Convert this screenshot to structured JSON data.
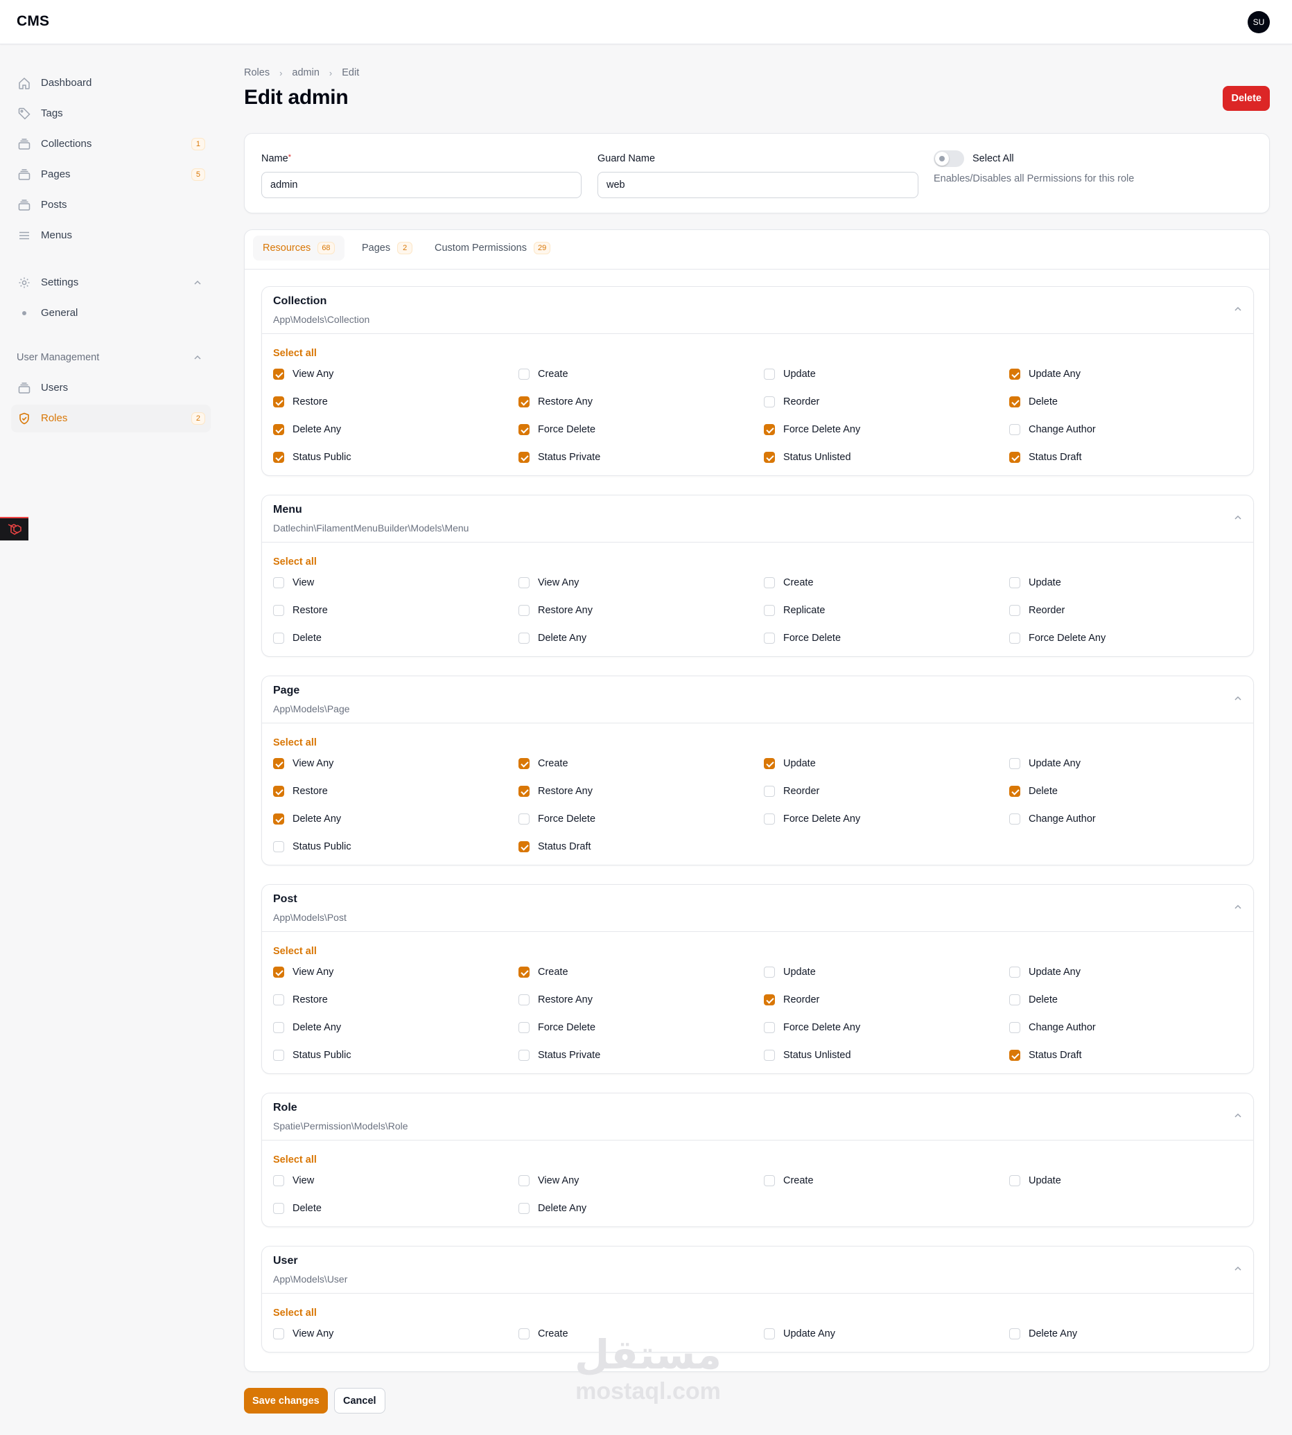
{
  "app": {
    "title": "CMS",
    "user_initials": "SU"
  },
  "sidebar": {
    "items": [
      {
        "label": "Dashboard",
        "icon": "home-icon"
      },
      {
        "label": "Tags",
        "icon": "tag-icon"
      },
      {
        "label": "Collections",
        "icon": "collection-icon",
        "badge": "1"
      },
      {
        "label": "Pages",
        "icon": "pages-icon",
        "badge": "5"
      },
      {
        "label": "Posts",
        "icon": "posts-icon"
      },
      {
        "label": "Menus",
        "icon": "menu-icon"
      }
    ],
    "settings": {
      "label": "Settings",
      "icon": "gear-icon",
      "children": [
        {
          "label": "General"
        }
      ]
    },
    "user_management": {
      "label": "User Management",
      "items": [
        {
          "label": "Users",
          "icon": "users-icon"
        },
        {
          "label": "Roles",
          "icon": "shield-icon",
          "badge": "2",
          "active": true
        }
      ]
    }
  },
  "breadcrumb": [
    "Roles",
    "admin",
    "Edit"
  ],
  "page": {
    "title": "Edit admin",
    "delete_label": "Delete"
  },
  "form": {
    "name": {
      "label": "Name",
      "required_mark": "*",
      "value": "admin"
    },
    "guard": {
      "label": "Guard Name",
      "value": "web"
    },
    "select_all": {
      "label": "Select All",
      "help": "Enables/Disables all Permissions for this role",
      "on": false
    }
  },
  "tabs": [
    {
      "label": "Resources",
      "count": "68",
      "active": true
    },
    {
      "label": "Pages",
      "count": "2"
    },
    {
      "label": "Custom Permissions",
      "count": "29"
    }
  ],
  "select_all_link": "Select all",
  "sections": [
    {
      "title": "Collection",
      "subtitle": "App\\Models\\Collection",
      "permissions": [
        {
          "label": "View Any",
          "checked": true
        },
        {
          "label": "Create",
          "checked": false
        },
        {
          "label": "Update",
          "checked": false
        },
        {
          "label": "Update Any",
          "checked": true
        },
        {
          "label": "Restore",
          "checked": true
        },
        {
          "label": "Restore Any",
          "checked": true
        },
        {
          "label": "Reorder",
          "checked": false
        },
        {
          "label": "Delete",
          "checked": true
        },
        {
          "label": "Delete Any",
          "checked": true
        },
        {
          "label": "Force Delete",
          "checked": true
        },
        {
          "label": "Force Delete Any",
          "checked": true
        },
        {
          "label": "Change Author",
          "checked": false
        },
        {
          "label": "Status Public",
          "checked": true
        },
        {
          "label": "Status Private",
          "checked": true
        },
        {
          "label": "Status Unlisted",
          "checked": true
        },
        {
          "label": "Status Draft",
          "checked": true
        }
      ]
    },
    {
      "title": "Menu",
      "subtitle": "Datlechin\\FilamentMenuBuilder\\Models\\Menu",
      "permissions": [
        {
          "label": "View",
          "checked": false
        },
        {
          "label": "View Any",
          "checked": false
        },
        {
          "label": "Create",
          "checked": false
        },
        {
          "label": "Update",
          "checked": false
        },
        {
          "label": "Restore",
          "checked": false
        },
        {
          "label": "Restore Any",
          "checked": false
        },
        {
          "label": "Replicate",
          "checked": false
        },
        {
          "label": "Reorder",
          "checked": false
        },
        {
          "label": "Delete",
          "checked": false
        },
        {
          "label": "Delete Any",
          "checked": false
        },
        {
          "label": "Force Delete",
          "checked": false
        },
        {
          "label": "Force Delete Any",
          "checked": false
        }
      ]
    },
    {
      "title": "Page",
      "subtitle": "App\\Models\\Page",
      "permissions": [
        {
          "label": "View Any",
          "checked": true
        },
        {
          "label": "Create",
          "checked": true
        },
        {
          "label": "Update",
          "checked": true
        },
        {
          "label": "Update Any",
          "checked": false
        },
        {
          "label": "Restore",
          "checked": true
        },
        {
          "label": "Restore Any",
          "checked": true
        },
        {
          "label": "Reorder",
          "checked": false
        },
        {
          "label": "Delete",
          "checked": true
        },
        {
          "label": "Delete Any",
          "checked": true
        },
        {
          "label": "Force Delete",
          "checked": false
        },
        {
          "label": "Force Delete Any",
          "checked": false
        },
        {
          "label": "Change Author",
          "checked": false
        },
        {
          "label": "Status Public",
          "checked": false
        },
        {
          "label": "Status Draft",
          "checked": true
        }
      ]
    },
    {
      "title": "Post",
      "subtitle": "App\\Models\\Post",
      "permissions": [
        {
          "label": "View Any",
          "checked": true
        },
        {
          "label": "Create",
          "checked": true
        },
        {
          "label": "Update",
          "checked": false
        },
        {
          "label": "Update Any",
          "checked": false
        },
        {
          "label": "Restore",
          "checked": false
        },
        {
          "label": "Restore Any",
          "checked": false
        },
        {
          "label": "Reorder",
          "checked": true
        },
        {
          "label": "Delete",
          "checked": false
        },
        {
          "label": "Delete Any",
          "checked": false
        },
        {
          "label": "Force Delete",
          "checked": false
        },
        {
          "label": "Force Delete Any",
          "checked": false
        },
        {
          "label": "Change Author",
          "checked": false
        },
        {
          "label": "Status Public",
          "checked": false
        },
        {
          "label": "Status Private",
          "checked": false
        },
        {
          "label": "Status Unlisted",
          "checked": false
        },
        {
          "label": "Status Draft",
          "checked": true
        }
      ]
    },
    {
      "title": "Role",
      "subtitle": "Spatie\\Permission\\Models\\Role",
      "permissions": [
        {
          "label": "View",
          "checked": false
        },
        {
          "label": "View Any",
          "checked": false
        },
        {
          "label": "Create",
          "checked": false
        },
        {
          "label": "Update",
          "checked": false
        },
        {
          "label": "Delete",
          "checked": false
        },
        {
          "label": "Delete Any",
          "checked": false
        }
      ]
    },
    {
      "title": "User",
      "subtitle": "App\\Models\\User",
      "permissions": [
        {
          "label": "View Any",
          "checked": false
        },
        {
          "label": "Create",
          "checked": false
        },
        {
          "label": "Update Any",
          "checked": false
        },
        {
          "label": "Delete Any",
          "checked": false
        }
      ]
    }
  ],
  "actions": {
    "save_label": "Save changes",
    "cancel_label": "Cancel"
  },
  "watermark": {
    "arabic": "مستقل",
    "latin": "mostaql.com"
  },
  "colors": {
    "primary": "#d97706",
    "danger": "#dc2626",
    "background": "#f7f7f8"
  }
}
